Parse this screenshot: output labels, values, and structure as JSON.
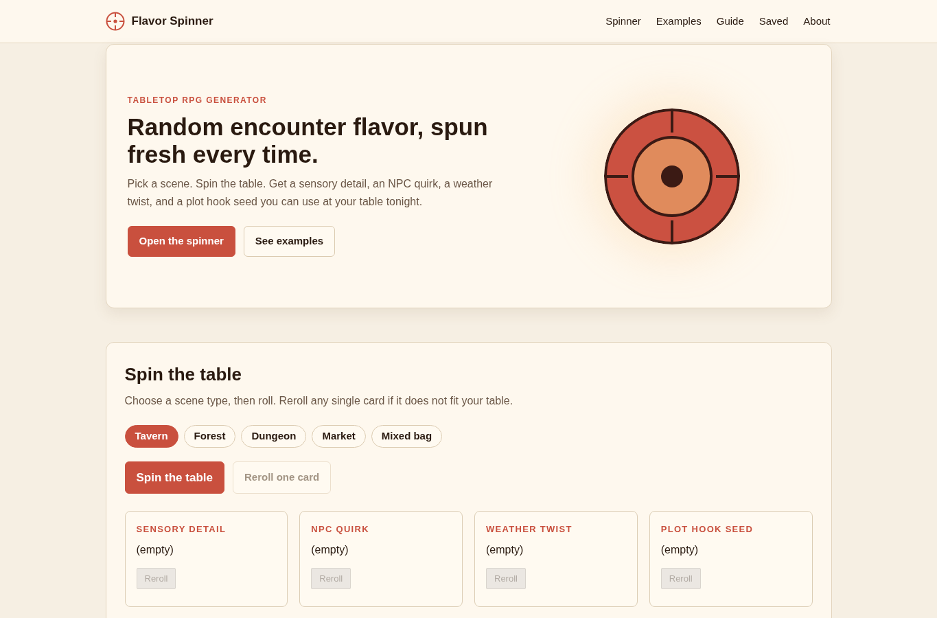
{
  "header": {
    "brand": "Flavor Spinner",
    "nav": [
      "Spinner",
      "Examples",
      "Guide",
      "Saved",
      "About"
    ]
  },
  "hero": {
    "eyebrow": "TABLETOP RPG GENERATOR",
    "title": "Random encounter flavor, spun fresh every time.",
    "description": "Pick a scene. Spin the table. Get a sensory detail, an NPC quirk, a weather twist, and a plot hook seed you can use at your table tonight.",
    "buttons": [
      {
        "label": "Open the spinner",
        "kind": "primary"
      },
      {
        "label": "See examples",
        "kind": "secondary"
      }
    ]
  },
  "spinner": {
    "title": "Spin the table",
    "description": "Choose a scene type, then roll. Reroll any single card if it does not fit your table.",
    "scenes": [
      {
        "label": "Tavern",
        "selected": true
      },
      {
        "label": "Forest",
        "selected": false
      },
      {
        "label": "Dungeon",
        "selected": false
      },
      {
        "label": "Market",
        "selected": false
      },
      {
        "label": "Mixed bag",
        "selected": false
      }
    ],
    "actions": [
      {
        "label": "Spin the table",
        "kind": "primary",
        "disabled": false
      },
      {
        "label": "Reroll one card",
        "kind": "secondary",
        "disabled": true
      }
    ],
    "cards": [
      {
        "label": "SENSORY DETAIL",
        "value": "(empty)",
        "button": {
          "label": "Reroll",
          "disabled": true
        }
      },
      {
        "label": "NPC QUIRK",
        "value": "(empty)",
        "button": {
          "label": "Reroll",
          "disabled": true
        }
      },
      {
        "label": "WEATHER TWIST",
        "value": "(empty)",
        "button": {
          "label": "Reroll",
          "disabled": true
        }
      },
      {
        "label": "PLOT HOOK SEED",
        "value": "(empty)",
        "button": {
          "label": "Reroll",
          "disabled": true
        }
      }
    ]
  }
}
